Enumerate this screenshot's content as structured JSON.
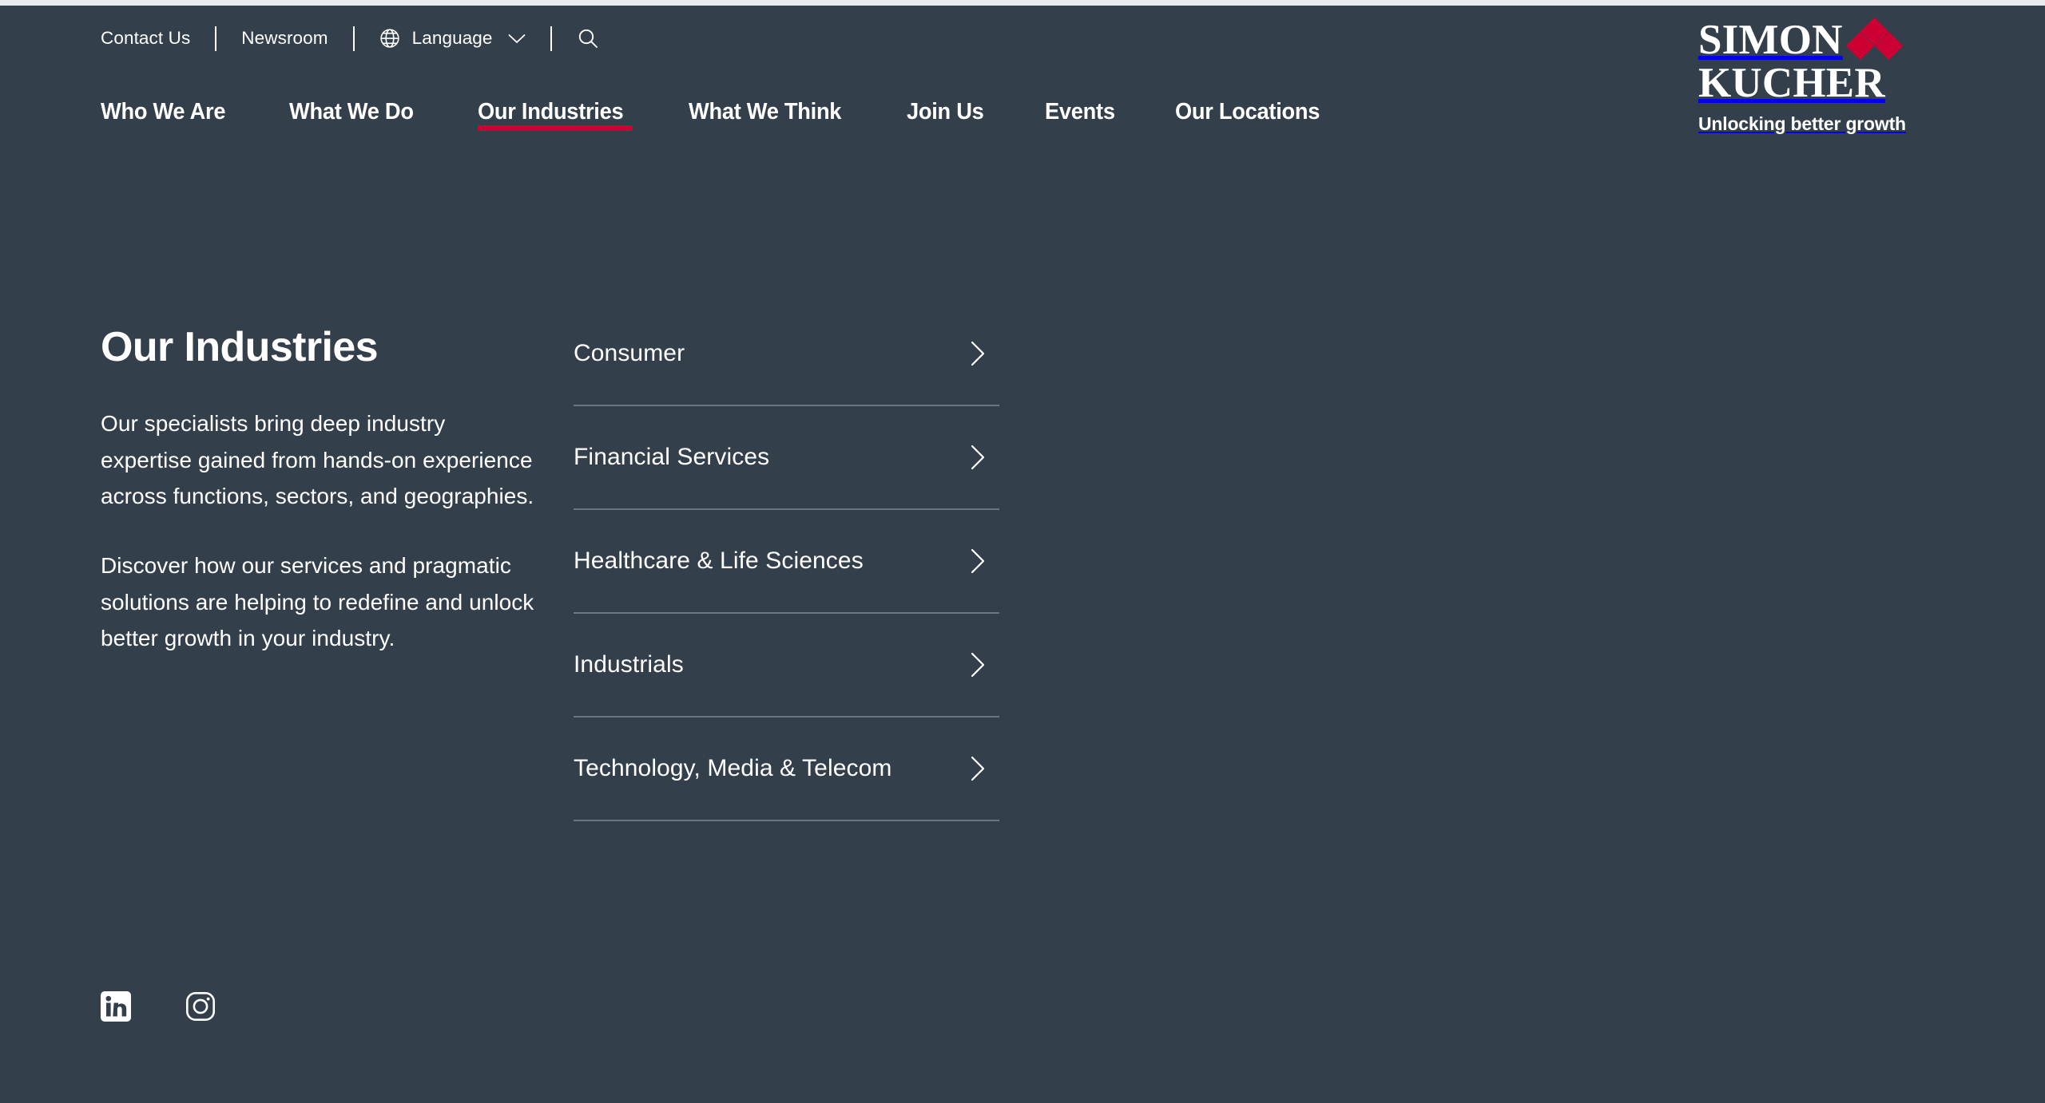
{
  "theme": {
    "background": "#333f4a",
    "accent_red": "#cc0033",
    "text": "#ffffff",
    "rule": "#6a7783",
    "page_strip": "#e9ecef"
  },
  "utility_bar": {
    "contact_label": "Contact Us",
    "newsroom_label": "Newsroom",
    "language_label": "Language",
    "globe_icon": "globe-icon",
    "chevron_icon": "chevron-down-icon",
    "search_icon": "search-icon"
  },
  "main_nav": {
    "items": [
      {
        "label": "Who We Are",
        "active": false
      },
      {
        "label": "What We Do",
        "active": false
      },
      {
        "label": "Our Industries",
        "active": true
      },
      {
        "label": "What We Think",
        "active": false
      },
      {
        "label": "Join Us",
        "active": false
      },
      {
        "label": "Events",
        "active": false
      },
      {
        "label": "Our Locations",
        "active": false
      }
    ]
  },
  "logo": {
    "line1": "SIMON",
    "line2": "KUCHER",
    "tagline": "Unlocking better growth",
    "mark": "diamond-cluster-icon"
  },
  "panel": {
    "title": "Our Industries",
    "paragraph1": "Our specialists bring deep industry expertise gained from hands-on experience across functions, sectors, and geographies.",
    "paragraph2": "Discover how our services and pragmatic solutions are helping to redefine and unlock better growth in your industry.",
    "industries": [
      {
        "label": "Consumer",
        "icon": "chevron-right-icon"
      },
      {
        "label": "Financial Services",
        "icon": "chevron-right-icon"
      },
      {
        "label": "Healthcare & Life Sciences",
        "icon": "chevron-right-icon"
      },
      {
        "label": "Industrials",
        "icon": "chevron-right-icon"
      },
      {
        "label": "Technology, Media & Telecom",
        "icon": "chevron-right-icon"
      }
    ]
  },
  "social": {
    "items": [
      {
        "name": "linkedin",
        "label": "LinkedIn"
      },
      {
        "name": "instagram",
        "label": "Instagram"
      }
    ]
  }
}
